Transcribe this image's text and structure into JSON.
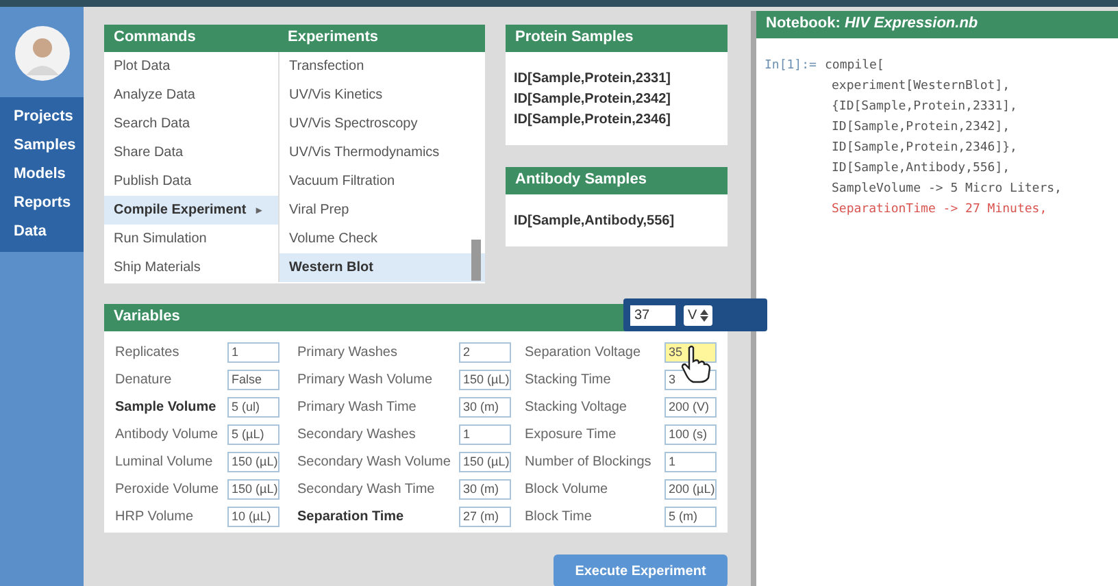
{
  "sidebar": {
    "items": [
      {
        "label": "Projects",
        "selected": false
      },
      {
        "label": "Samples",
        "selected": false
      },
      {
        "label": "Models",
        "selected": false
      },
      {
        "label": "Reports",
        "selected": false
      },
      {
        "label": "Data",
        "selected": false
      }
    ]
  },
  "commands": {
    "title": "Commands",
    "items": [
      {
        "label": "Plot Data",
        "selected": false
      },
      {
        "label": "Analyze Data",
        "selected": false
      },
      {
        "label": "Search Data",
        "selected": false
      },
      {
        "label": "Share Data",
        "selected": false
      },
      {
        "label": "Publish Data",
        "selected": false
      },
      {
        "label": "Compile Experiment",
        "selected": true,
        "arrow": "▸"
      },
      {
        "label": "Run Simulation",
        "selected": false
      },
      {
        "label": "Ship Materials",
        "selected": false
      }
    ]
  },
  "experiments": {
    "title": "Experiments",
    "items": [
      {
        "label": "Transfection",
        "selected": false
      },
      {
        "label": "UV/Vis Kinetics",
        "selected": false
      },
      {
        "label": "UV/Vis Spectroscopy",
        "selected": false
      },
      {
        "label": "UV/Vis Thermodynamics",
        "selected": false
      },
      {
        "label": "Vacuum Filtration",
        "selected": false
      },
      {
        "label": "Viral Prep",
        "selected": false
      },
      {
        "label": "Volume Check",
        "selected": false
      },
      {
        "label": "Western Blot",
        "selected": true
      }
    ]
  },
  "protein_samples": {
    "title": "Protein Samples",
    "items": [
      "ID[Sample,Protein,2331]",
      "ID[Sample,Protein,2342]",
      "ID[Sample,Protein,2346]"
    ]
  },
  "antibody_samples": {
    "title": "Antibody Samples",
    "items": [
      "ID[Sample,Antibody,556]"
    ]
  },
  "variables": {
    "title": "Variables",
    "columns": [
      [
        {
          "label": "Replicates",
          "value": "1",
          "bold": false
        },
        {
          "label": "Denature",
          "value": "False",
          "bold": false
        },
        {
          "label": "Sample Volume",
          "value": "5 (ul)",
          "bold": true
        },
        {
          "label": "Antibody Volume",
          "value": "5 (µL)",
          "bold": false
        },
        {
          "label": "Luminal Volume",
          "value": "150 (µL)",
          "bold": false
        },
        {
          "label": "Peroxide Volume",
          "value": "150 (µL)",
          "bold": false
        },
        {
          "label": "HRP Volume",
          "value": "10 (µL)",
          "bold": false
        }
      ],
      [
        {
          "label": "Primary Washes",
          "value": "2",
          "bold": false
        },
        {
          "label": "Primary Wash Volume",
          "value": "150 (µL)",
          "bold": false
        },
        {
          "label": "Primary Wash Time",
          "value": "30 (m)",
          "bold": false
        },
        {
          "label": "Secondary Washes",
          "value": "1",
          "bold": false
        },
        {
          "label": "Secondary Wash Volume",
          "value": "150 (µL)",
          "bold": false
        },
        {
          "label": "Secondary Wash Time",
          "value": "30 (m)",
          "bold": false
        },
        {
          "label": "Separation Time",
          "value": "27 (m)",
          "bold": true
        }
      ],
      [
        {
          "label": "Separation Voltage",
          "value": "35",
          "bold": false,
          "highlighted": true
        },
        {
          "label": "Stacking Time",
          "value": "3",
          "bold": false
        },
        {
          "label": "Stacking Voltage",
          "value": "200 (V)",
          "bold": false
        },
        {
          "label": "Exposure Time",
          "value": "100 (s)",
          "bold": false
        },
        {
          "label": "Number of Blockings",
          "value": "1",
          "bold": false
        },
        {
          "label": "Block Volume",
          "value": "200 (µL)",
          "bold": false
        },
        {
          "label": "Block Time",
          "value": "5 (m)",
          "bold": false
        }
      ]
    ]
  },
  "popup": {
    "value": "37",
    "unit": "V"
  },
  "execute_button": "Execute Experiment",
  "notebook": {
    "title_prefix": "Notebook:",
    "title_name": "HIV Expression.nb",
    "prompt": "In[1]:=",
    "lines": [
      {
        "text": "compile[",
        "error": false
      },
      {
        "text": "experiment[WesternBlot],",
        "error": false
      },
      {
        "text": "{ID[Sample,Protein,2331],",
        "error": false
      },
      {
        "text": "ID[Sample,Protein,2342],",
        "error": false
      },
      {
        "text": "ID[Sample,Protein,2346]},",
        "error": false
      },
      {
        "text": "ID[Sample,Antibody,556],",
        "error": false
      },
      {
        "text": "SampleVolume -> 5 Micro Liters,",
        "error": false
      },
      {
        "text": "SeparationTime -> 27 Minutes,",
        "error": true
      }
    ]
  }
}
